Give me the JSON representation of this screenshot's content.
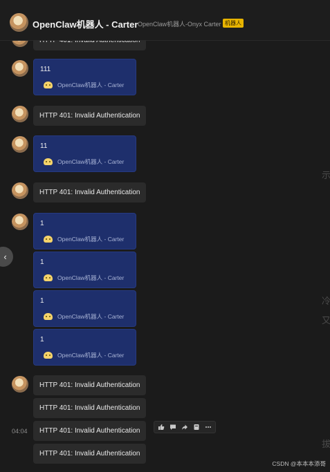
{
  "header": {
    "title": "OpenClaw机器人 - Carter",
    "subtitle": "OpenClaw机器人-Onyx Carter",
    "badge": "机器人"
  },
  "messages": [
    {
      "kind": "gray",
      "text": "HTTP 401: Invalid Authentication"
    },
    {
      "kind": "blue",
      "text": "111",
      "ref": "OpenClaw机器人 - Carter"
    },
    {
      "kind": "gray",
      "text": "HTTP 401: Invalid Authentication"
    },
    {
      "kind": "blue",
      "text": "11",
      "ref": "OpenClaw机器人 - Carter"
    },
    {
      "kind": "gray",
      "text": "HTTP 401: Invalid Authentication"
    },
    {
      "kind": "blue",
      "text": "1",
      "ref": "OpenClaw机器人 - Carter"
    },
    {
      "kind": "blue",
      "text": "1",
      "ref": "OpenClaw机器人 - Carter"
    },
    {
      "kind": "blue",
      "text": "1",
      "ref": "OpenClaw机器人 - Carter"
    },
    {
      "kind": "blue",
      "text": "1",
      "ref": "OpenClaw机器人 - Carter"
    },
    {
      "kind": "gray",
      "text": "HTTP 401: Invalid Authentication"
    },
    {
      "kind": "gray",
      "text": "HTTP 401: Invalid Authentication"
    },
    {
      "kind": "gray",
      "text": "HTTP 401: Invalid Authentication"
    },
    {
      "kind": "gray",
      "text": "HTTP 401: Invalid Authentication"
    }
  ],
  "time": "04:04",
  "toolbar": {
    "icons": [
      "thumbs-up-icon",
      "comment-icon",
      "forward-icon",
      "bookmark-icon",
      "more-icon"
    ]
  },
  "side_arrow": "‹",
  "edge_fragments": [
    "示",
    "冷",
    "又",
    "拔"
  ],
  "watermark": "CSDN @本本本添哥"
}
